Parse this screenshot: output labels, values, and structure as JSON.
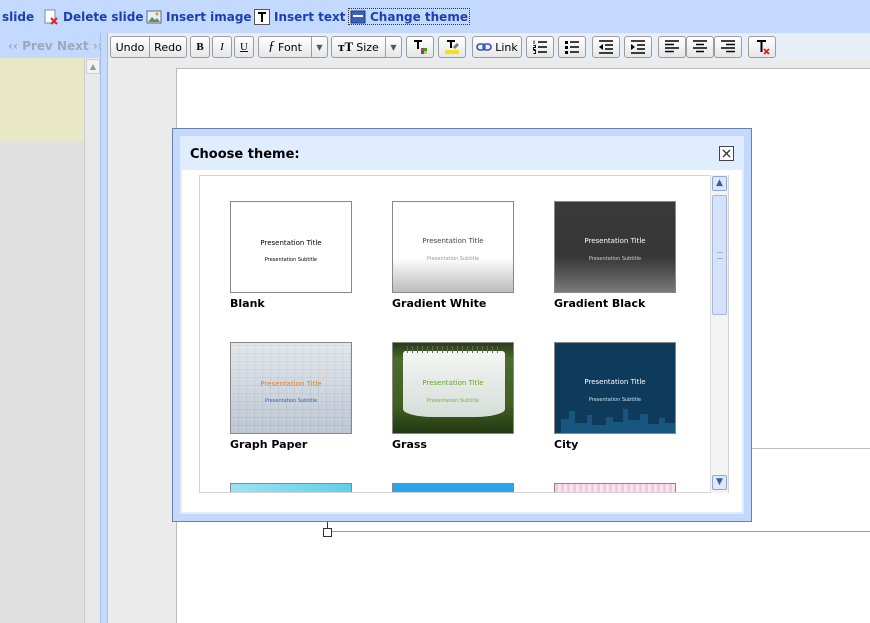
{
  "actions": {
    "new_slide": "slide",
    "delete_slide": "Delete slide",
    "insert_image": "Insert image",
    "insert_text": "Insert text",
    "change_theme": "Change theme"
  },
  "nav": {
    "prev": "‹‹ Prev",
    "next": "Next ››"
  },
  "toolbar": {
    "undo": "Undo",
    "redo": "Redo",
    "bold": "B",
    "italic": "I",
    "underline": "U",
    "font": "Font",
    "size": "Size",
    "link": "Link"
  },
  "dialog": {
    "title": "Choose theme:",
    "themes": [
      {
        "name": "Blank",
        "title": "Presentation Title",
        "subtitle": "Presentation Subtitle"
      },
      {
        "name": "Gradient White",
        "title": "Presentation Title",
        "subtitle": "Presentation Subtitle"
      },
      {
        "name": "Gradient Black",
        "title": "Presentation Title",
        "subtitle": "Presentation Subtitle"
      },
      {
        "name": "Graph Paper",
        "title": "Presentation Title",
        "subtitle": "Presentation Subtitle"
      },
      {
        "name": "Grass",
        "title": "Presentation Title",
        "subtitle": "Presentation Subtitle"
      },
      {
        "name": "City",
        "title": "Presentation Title",
        "subtitle": "Presentation Subtitle"
      }
    ]
  },
  "colors": {
    "accent_link": "#1c3fb3",
    "chrome": "#c3d9ff",
    "dialog_header": "#e0ecff"
  }
}
